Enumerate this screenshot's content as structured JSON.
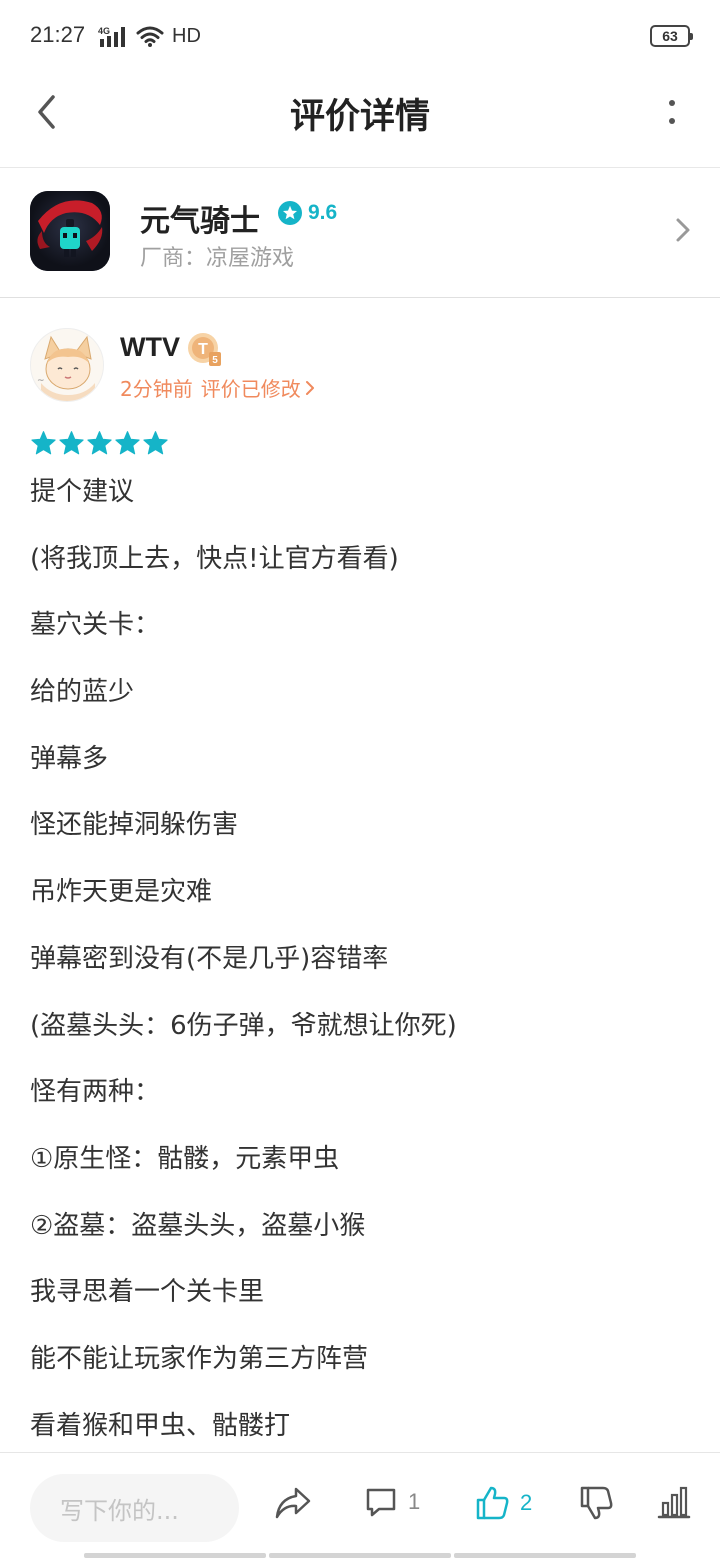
{
  "status_bar": {
    "time": "21:27",
    "network": "4G",
    "hd_label": "HD",
    "battery": "63"
  },
  "header": {
    "title": "评价详情",
    "back_icon": "chevron-left-icon",
    "more_icon": "more-vertical-icon"
  },
  "app": {
    "name": "元气骑士",
    "rating": "9.6",
    "developer": "厂商：凉屋游戏",
    "accent_color": "#15b4c8"
  },
  "review": {
    "user_name": "WTV",
    "badge_level": "T5",
    "time_ago": "2分钟前",
    "edited_label": "评价已修改",
    "stars": 5,
    "lines": [
      "提个建议",
      "(将我顶上去，快点!让官方看看)",
      "墓穴关卡：",
      "给的蓝少",
      "弹幕多",
      "怪还能掉洞躲伤害",
      "吊炸天更是灾难",
      "弹幕密到没有(不是几乎)容错率",
      "(盗墓头头：6伤子弹，爷就想让你死)",
      "怪有两种：",
      "①原生怪：骷髅，元素甲虫",
      "②盗墓：盗墓头头，盗墓小猴",
      "我寻思着一个关卡里",
      "能不能让玩家作为第三方阵营",
      "看着猴和甲虫、骷髅打"
    ]
  },
  "bottom_bar": {
    "comment_placeholder": "写下你的...",
    "comment_count": "1",
    "like_count": "2"
  }
}
